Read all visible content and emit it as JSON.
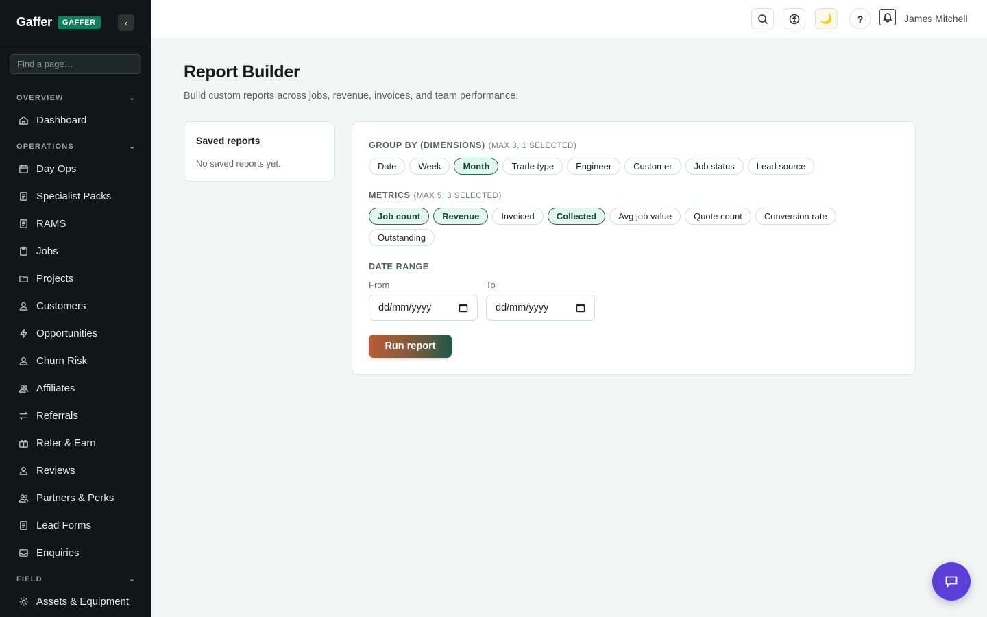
{
  "brand": {
    "name": "Gaffer",
    "badge": "GAFFER",
    "collapse_icon": "‹"
  },
  "sidebar": {
    "search_placeholder": "Find a page…",
    "sections": {
      "overview": "OVERVIEW",
      "operations": "OPERATIONS",
      "field": "FIELD"
    },
    "items": [
      {
        "label": "Dashboard",
        "icon": "home-icon"
      },
      {
        "label": "Day Ops",
        "icon": "calendar-icon"
      },
      {
        "label": "Specialist Packs",
        "icon": "document-icon"
      },
      {
        "label": "RAMS",
        "icon": "document-icon"
      },
      {
        "label": "Jobs",
        "icon": "clipboard-icon"
      },
      {
        "label": "Projects",
        "icon": "folder-icon"
      },
      {
        "label": "Customers",
        "icon": "user-icon"
      },
      {
        "label": "Opportunities",
        "icon": "lightning-icon"
      },
      {
        "label": "Churn Risk",
        "icon": "user-icon"
      },
      {
        "label": "Affiliates",
        "icon": "users-icon"
      },
      {
        "label": "Referrals",
        "icon": "arrows-icon"
      },
      {
        "label": "Refer & Earn",
        "icon": "gift-icon"
      },
      {
        "label": "Reviews",
        "icon": "user-icon"
      },
      {
        "label": "Partners & Perks",
        "icon": "users-icon"
      },
      {
        "label": "Lead Forms",
        "icon": "document-icon"
      },
      {
        "label": "Enquiries",
        "icon": "inbox-icon"
      },
      {
        "label": "Assets & Equipment",
        "icon": "gear-icon"
      }
    ]
  },
  "topbar": {
    "user_name": "James Mitchell",
    "help_label": "?",
    "moon_glyph": "🌙"
  },
  "page": {
    "title": "Report Builder",
    "subtitle": "Build custom reports across jobs, revenue, invoices, and team performance."
  },
  "saved_reports": {
    "title": "Saved reports",
    "empty": "No saved reports yet."
  },
  "builder": {
    "group_by": {
      "label": "GROUP BY (DIMENSIONS)",
      "hint": "(MAX 3, 1 SELECTED)",
      "options": [
        {
          "label": "Date",
          "selected": false
        },
        {
          "label": "Week",
          "selected": false
        },
        {
          "label": "Month",
          "selected": true
        },
        {
          "label": "Trade type",
          "selected": false
        },
        {
          "label": "Engineer",
          "selected": false
        },
        {
          "label": "Customer",
          "selected": false
        },
        {
          "label": "Job status",
          "selected": false
        },
        {
          "label": "Lead source",
          "selected": false
        }
      ]
    },
    "metrics": {
      "label": "METRICS",
      "hint": "(MAX 5, 3 SELECTED)",
      "options": [
        {
          "label": "Job count",
          "selected": true
        },
        {
          "label": "Revenue",
          "selected": true
        },
        {
          "label": "Invoiced",
          "selected": false
        },
        {
          "label": "Collected",
          "selected": true
        },
        {
          "label": "Avg job value",
          "selected": false
        },
        {
          "label": "Quote count",
          "selected": false
        },
        {
          "label": "Conversion rate",
          "selected": false
        },
        {
          "label": "Outstanding",
          "selected": false
        }
      ]
    },
    "date_range": {
      "label": "DATE RANGE",
      "from_label": "From",
      "to_label": "To",
      "from_value": "dd/mm/yyyy",
      "to_value": "dd/mm/yyyy"
    },
    "run_label": "Run report"
  },
  "colors": {
    "sidebar_bg": "#101716",
    "accent": "#137a5c",
    "chip_selected_border": "#1d6b55",
    "fab": "#5b3fd6"
  }
}
